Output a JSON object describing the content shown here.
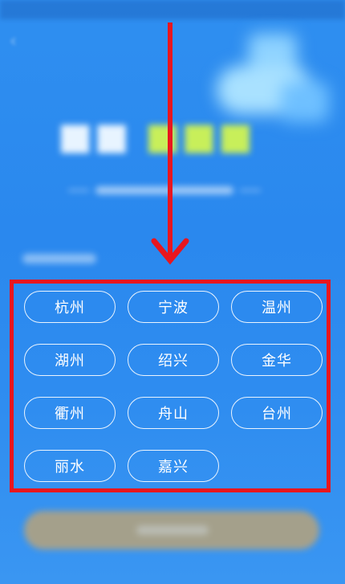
{
  "cities": [
    {
      "label": "杭州"
    },
    {
      "label": "宁波"
    },
    {
      "label": "温州"
    },
    {
      "label": "湖州"
    },
    {
      "label": "绍兴"
    },
    {
      "label": "金华"
    },
    {
      "label": "衢州"
    },
    {
      "label": "舟山"
    },
    {
      "label": "台州"
    },
    {
      "label": "丽水"
    },
    {
      "label": "嘉兴"
    }
  ],
  "colors": {
    "background": "#2f8ff0",
    "annotation": "#e8161e",
    "headline_accent": "#c8ef5a"
  }
}
